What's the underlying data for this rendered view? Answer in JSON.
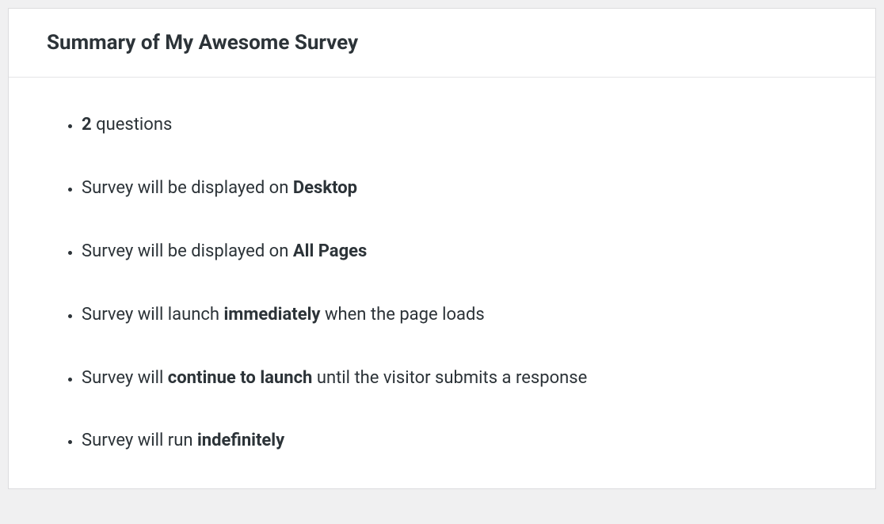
{
  "header": {
    "title": "Summary of My Awesome Survey"
  },
  "items": [
    {
      "prefix": "",
      "bold": "2",
      "suffix": " questions"
    },
    {
      "prefix": "Survey will be displayed on ",
      "bold": "Desktop",
      "suffix": ""
    },
    {
      "prefix": "Survey will be displayed on ",
      "bold": "All Pages",
      "suffix": ""
    },
    {
      "prefix": "Survey will launch ",
      "bold": "immediately",
      "suffix": " when the page loads"
    },
    {
      "prefix": "Survey will ",
      "bold": "continue to launch",
      "suffix": " until the visitor submits a response"
    },
    {
      "prefix": "Survey will run ",
      "bold": "indefinitely",
      "suffix": ""
    }
  ]
}
